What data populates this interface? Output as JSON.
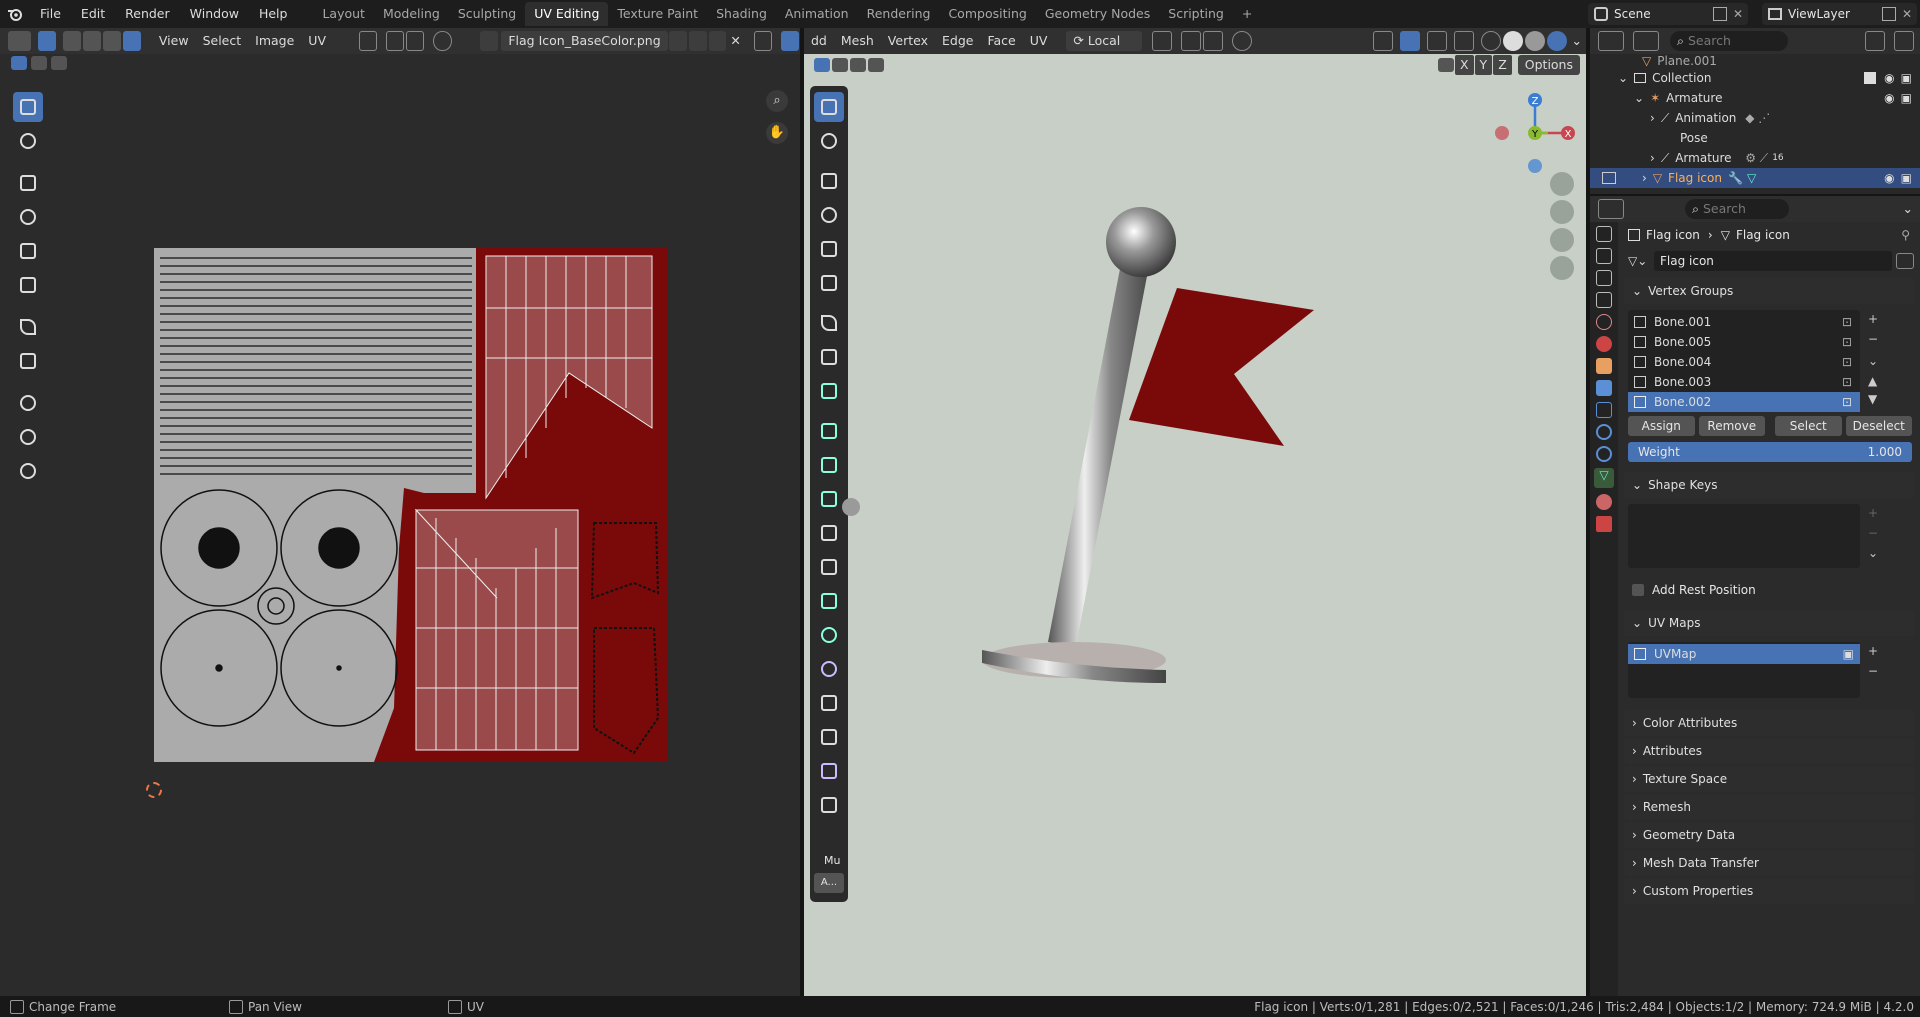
{
  "topbar": {
    "menus": [
      "File",
      "Edit",
      "Render",
      "Window",
      "Help"
    ],
    "workspaces": [
      "Layout",
      "Modeling",
      "Sculpting",
      "UV Editing",
      "Texture Paint",
      "Shading",
      "Animation",
      "Rendering",
      "Compositing",
      "Geometry Nodes",
      "Scripting"
    ],
    "active_workspace": "UV Editing",
    "add_label": "+",
    "scene": "Scene",
    "view_layer": "ViewLayer"
  },
  "uv_editor": {
    "menus": [
      "View",
      "Select",
      "Image",
      "UV"
    ],
    "image_name": "Flag Icon_BaseColor.png"
  },
  "viewport": {
    "menus": [
      "dd",
      "Mesh",
      "Vertex",
      "Edge",
      "Face",
      "UV"
    ],
    "transform_orientation": "Local",
    "axes": [
      "X",
      "Y",
      "Z"
    ],
    "options_label": "Options",
    "gizmo": {
      "z": "Z",
      "y": "Y",
      "x": "X"
    },
    "panel_label": "Mu",
    "panel_btn": "A..."
  },
  "outliner": {
    "search_placeholder": "Search",
    "rows": [
      {
        "label": "Plane.001",
        "indent": 0
      },
      {
        "label": "Collection",
        "indent": 0
      },
      {
        "label": "Armature",
        "indent": 1
      },
      {
        "label": "Animation",
        "indent": 2
      },
      {
        "label": "Pose",
        "indent": 2
      },
      {
        "label": "Armature",
        "indent": 2
      },
      {
        "label": "Flag icon",
        "indent": 1
      }
    ],
    "armature_count": "16"
  },
  "properties": {
    "search_placeholder": "Search",
    "breadcrumb": [
      "Flag icon",
      "Flag icon"
    ],
    "mesh_name": "Flag icon",
    "vertex_groups_title": "Vertex Groups",
    "vertex_groups": [
      "Bone.001",
      "Bone.005",
      "Bone.004",
      "Bone.003",
      "Bone.002"
    ],
    "active_vertex_group": "Bone.002",
    "vg_buttons": [
      "Assign",
      "Remove",
      "Select",
      "Deselect"
    ],
    "weight_label": "Weight",
    "weight_value": "1.000",
    "shape_keys_title": "Shape Keys",
    "add_rest_position": "Add Rest Position",
    "uv_maps_title": "UV Maps",
    "uv_map": "UVMap",
    "collapsed_panels": [
      "Color Attributes",
      "Attributes",
      "Texture Space",
      "Remesh",
      "Geometry Data",
      "Mesh Data Transfer",
      "Custom Properties"
    ]
  },
  "status": {
    "left": [
      "Change Frame",
      "Pan View",
      "UV"
    ],
    "right": "Flag icon | Verts:0/1,281 | Edges:0/2,521 | Faces:0/1,246 | Tris:2,484 | Objects:1/2 | Memory: 724.9 MiB | 4.2.0"
  },
  "colors": {
    "accent": "#4772b3",
    "flag": "#7a0a0a",
    "viewport_bg": "#c7cfc6",
    "x": "#c8464f",
    "y": "#8aba31",
    "z": "#3b7dd3"
  }
}
